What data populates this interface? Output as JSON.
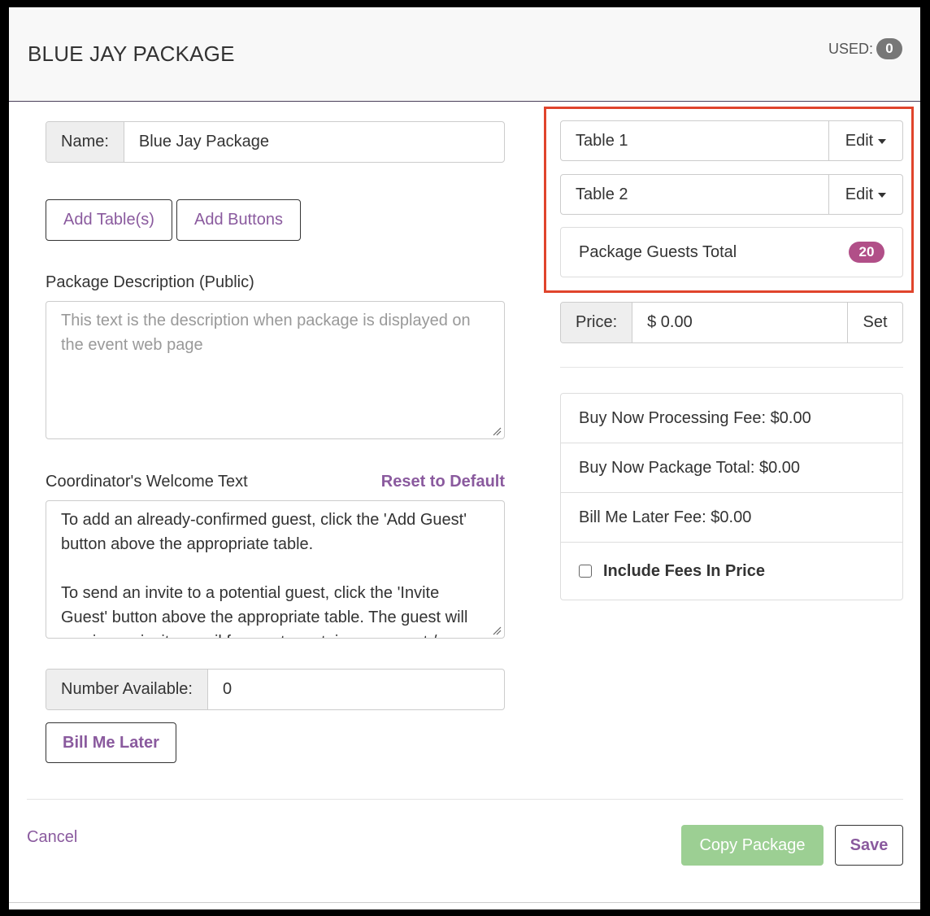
{
  "header": {
    "title": "BLUE JAY PACKAGE",
    "used_label": "USED:",
    "used_count": "0"
  },
  "name_field": {
    "label": "Name:",
    "value": "Blue Jay Package"
  },
  "buttons": {
    "add_tables": "Add Table(s)",
    "add_buttons": "Add Buttons",
    "bill_me_later": "Bill Me Later",
    "cancel": "Cancel",
    "copy_package": "Copy Package",
    "save": "Save"
  },
  "description": {
    "label": "Package Description (Public)",
    "placeholder": "This text is the description when package is displayed on the event web page"
  },
  "welcome": {
    "label": "Coordinator's Welcome Text",
    "reset_label": "Reset to Default",
    "paragraph1": "To add an already-confirmed guest, click the 'Add Guest' button above the appropriate table.",
    "paragraph2": "To send an invite to a potential guest, click the 'Invite Guest' button above the appropriate table. The guest will receive an invite email for you to certain your guest / a"
  },
  "number_available": {
    "label": "Number Available:",
    "value": "0"
  },
  "tables": [
    {
      "name": "Table 1",
      "edit_label": "Edit"
    },
    {
      "name": "Table 2",
      "edit_label": "Edit"
    }
  ],
  "guests_total": {
    "label": "Package Guests Total",
    "count": "20"
  },
  "price": {
    "label": "Price:",
    "value": "$ 0.00",
    "set_label": "Set"
  },
  "fees": {
    "processing_fee": "Buy Now Processing Fee: $0.00",
    "package_total": "Buy Now Package Total: $0.00",
    "bill_later_fee": "Bill Me Later Fee: $0.00",
    "include_fees_label": "Include Fees In Price",
    "include_fees_checked": false
  },
  "colors": {
    "accent": "#8a5a9e",
    "badge_pink": "#b14f88",
    "copy_button": "#9ccf93",
    "highlight_box": "#e0442c"
  }
}
